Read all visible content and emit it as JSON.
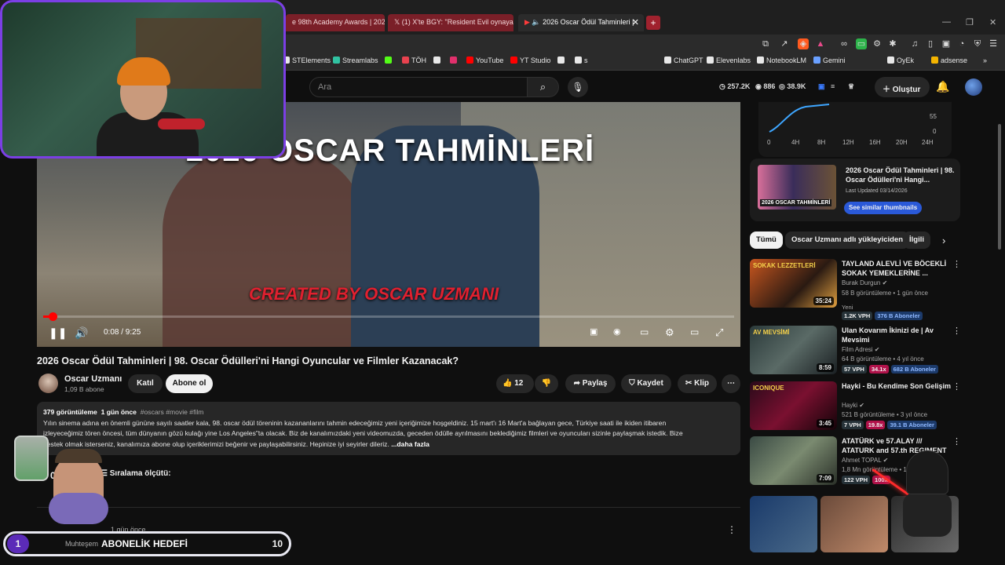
{
  "tabs": [
    {
      "label": "e 98th Academy Awards | 2026"
    },
    {
      "label": "(1) X'te BGY: \"Resident Evil oynayan"
    },
    {
      "label": "2026 Oscar Ödül Tahminleri |"
    }
  ],
  "bookmarks": [
    {
      "label": "STElements",
      "color": "#e8e8e8"
    },
    {
      "label": "Streamlabs",
      "color": "#31c3a2"
    },
    {
      "label": "",
      "color": "#53fc18"
    },
    {
      "label": "TÖH",
      "color": "#e8424f"
    },
    {
      "label": "",
      "color": "#e8e8e8"
    },
    {
      "label": "",
      "color": "#e1306c"
    },
    {
      "label": "YouTube",
      "color": "#ff0000"
    },
    {
      "label": "YT Studio",
      "color": "#ff0000"
    },
    {
      "label": "",
      "color": "#e8e8e8"
    },
    {
      "label": "s",
      "color": "#e8e8e8"
    },
    {
      "label": "ChatGPT",
      "color": "#e8e8e8"
    },
    {
      "label": "Elevenlabs",
      "color": "#e8e8e8"
    },
    {
      "label": "NotebookLM",
      "color": "#e8e8e8"
    },
    {
      "label": "Gemini",
      "color": "#6aa0ff"
    },
    {
      "label": "OyEk",
      "color": "#e8e8e8"
    },
    {
      "label": "adsense",
      "color": "#f4b400"
    }
  ],
  "header": {
    "search_placeholder": "Ara",
    "stats": [
      "257.2K",
      "886",
      "38.9K"
    ],
    "create_label": "Oluştur"
  },
  "video": {
    "overlay_title": "2026 OSCAR TAHMİNLERİ",
    "credit": "CREATED BY OSCAR UZMANI",
    "time": "0:08 / 9:25",
    "progress": 0.014,
    "title": "2026 Oscar Ödül Tahminleri | 98. Oscar Ödülleri'ni Hangi Oyuncular ve Filmler Kazanacak?"
  },
  "channel": {
    "name": "Oscar Uzmanı",
    "subs": "1,09 B abone",
    "join_label": "Katıl",
    "subscribe_label": "Abone ol"
  },
  "actions": {
    "likes": "12",
    "share": "Paylaş",
    "save": "Kaydet",
    "clip": "Klip"
  },
  "description": {
    "views": "379 görüntüleme",
    "age": "1 gün önce",
    "tags": "#oscars #movie #film",
    "line1": "Yılın sinema adına en önemli gününe sayılı saatler kala, 98. oscar ödül töreninin kazananlarını tahmin edeceğimiz yeni içeriğimize hoşgeldiniz. 15 mart'ı 16 Mart'a bağlayan gece, Türkiye saati ile ikiden itibaren",
    "line2": "izleyeceğimiz tören öncesi, tüm dünyanın gözü kulağı yine Los Angeles\"ta olacak. Biz de kanalımızdaki yeni videomuzda, geceden ödülle ayrılmasını beklediğimiz filmleri ve oyuncuları sizinle paylaşmak istedik. Bize",
    "line3": "destek olmak isterseniz, kanalımıza abone olup içeriklerimizi beğenir ve paylaşabilirsiniz. Hepinize iyi seyirler dileriz.",
    "more": "...daha fazla"
  },
  "comments": {
    "count_label": "0 Yo",
    "sort_label": "Sıralama ölçütü:",
    "first_age": "1 gün önce",
    "first_text": "Muhteşem"
  },
  "goal": {
    "current": "1",
    "label": "ABONELİK HEDEFİ",
    "target": "10"
  },
  "stats_card": {
    "y_ticks": [
      "55",
      "0"
    ],
    "x_ticks": [
      "0",
      "4H",
      "8H",
      "12H",
      "16H",
      "20H",
      "24H"
    ]
  },
  "thumb_card": {
    "caption": "2026 OSCAR TAHMİNLERİ",
    "title": "2026 Oscar Ödül Tahminleri | 98. Oscar Ödülleri'ni Hangi...",
    "updated": "Last Updated 03/14/2026",
    "button": "See similar thumbnails"
  },
  "chips": [
    "Tümü",
    "Oscar Uzmanı adlı yükleyiciden",
    "İlgili"
  ],
  "recommendations": [
    {
      "title": "TAYLAND ALEVLİ VE BÖCEKLİ SOKAK YEMEKLERİNE ...",
      "channel": "Burak Durgun",
      "meta": "58 B görüntüleme • 1 gün önce",
      "extra": "Yeni",
      "duration": "35:24",
      "vph": "1.2K VPH",
      "mult": "",
      "subs": "376 B Aboneler",
      "thumb": "linear-gradient(135deg,#c8561f,#2a1a12 60%,#e0a040)"
    },
    {
      "title": "Ulan Kovarım İkinizi de | Av Mevsimi",
      "channel": "Film Adresi",
      "meta": "64 B görüntüleme • 4 yıl önce",
      "extra": "",
      "duration": "8:59",
      "vph": "57 VPH",
      "mult": "34.1x",
      "subs": "682 B Aboneler",
      "thumb": "linear-gradient(135deg,#2b3a3a,#5a6a66 50%,#1a1f22)"
    },
    {
      "title": "Hayki - Bu Kendime Son Gelişim",
      "channel": "Hayki",
      "meta": "521 B görüntüleme • 3 yıl önce",
      "extra": "",
      "duration": "3:45",
      "vph": "7 VPH",
      "mult": "19.8x",
      "subs": "39.1 B Aboneler",
      "thumb": "linear-gradient(135deg,#2a0a1a,#7a1030 50%,#120408)"
    },
    {
      "title": "ATATÜRK ve 57.ALAY /// ATATURK and 57.th REGIMENT",
      "channel": "Ahmet TOPAL",
      "meta": "1,8 Mn görüntüleme • 1 y",
      "extra": "",
      "duration": "7:09",
      "vph": "122 VPH",
      "mult": "100x",
      "subs": "",
      "thumb": "linear-gradient(135deg,#3a4a44,#7a8a70 50%,#2a3028)"
    }
  ],
  "rec_thumb_texts": [
    "SOKAK LEZZETLERİ",
    "AV MEVSİMİ",
    "ICONIQUE"
  ],
  "colors": {
    "accent": "#ff0000",
    "webcam_border": "#7b3fe4",
    "goal_badge": "#5b2bb8"
  }
}
